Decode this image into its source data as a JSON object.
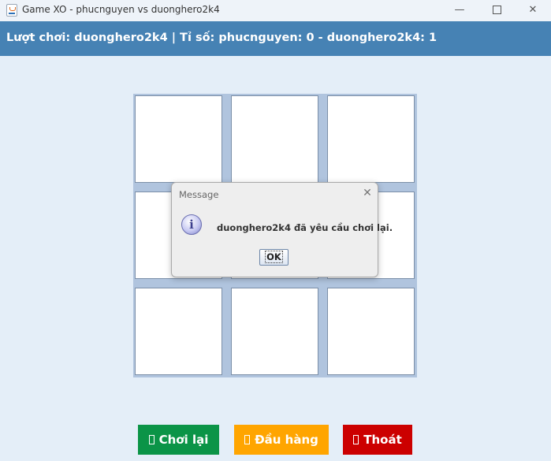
{
  "window": {
    "title": "Game XO - phucnguyen vs duonghero2k4",
    "minimize_glyph": "—",
    "close_glyph": "✕"
  },
  "status": {
    "text": "Lượt chơi: duonghero2k4 | Tỉ số: phucnguyen: 0 - duonghero2k4: 1"
  },
  "board": {
    "cells": [
      "",
      "",
      "",
      "",
      "",
      "",
      "",
      "",
      ""
    ]
  },
  "dialog": {
    "title": "Message",
    "close_glyph": "✕",
    "icon": "info-icon",
    "icon_glyph": "i",
    "message": "duonghero2k4 đã yêu cầu chơi lại.",
    "ok_label": "OK"
  },
  "actions": {
    "replay_label": "Chơi lại",
    "surrender_label": "Đầu hàng",
    "quit_label": "Thoát"
  },
  "colors": {
    "status_bar": "#4682b4",
    "replay": "#0b9447",
    "surrender": "#ffa500",
    "quit": "#cc0000",
    "board_bg": "#b0c4de",
    "window_bg": "#e4eef8"
  }
}
